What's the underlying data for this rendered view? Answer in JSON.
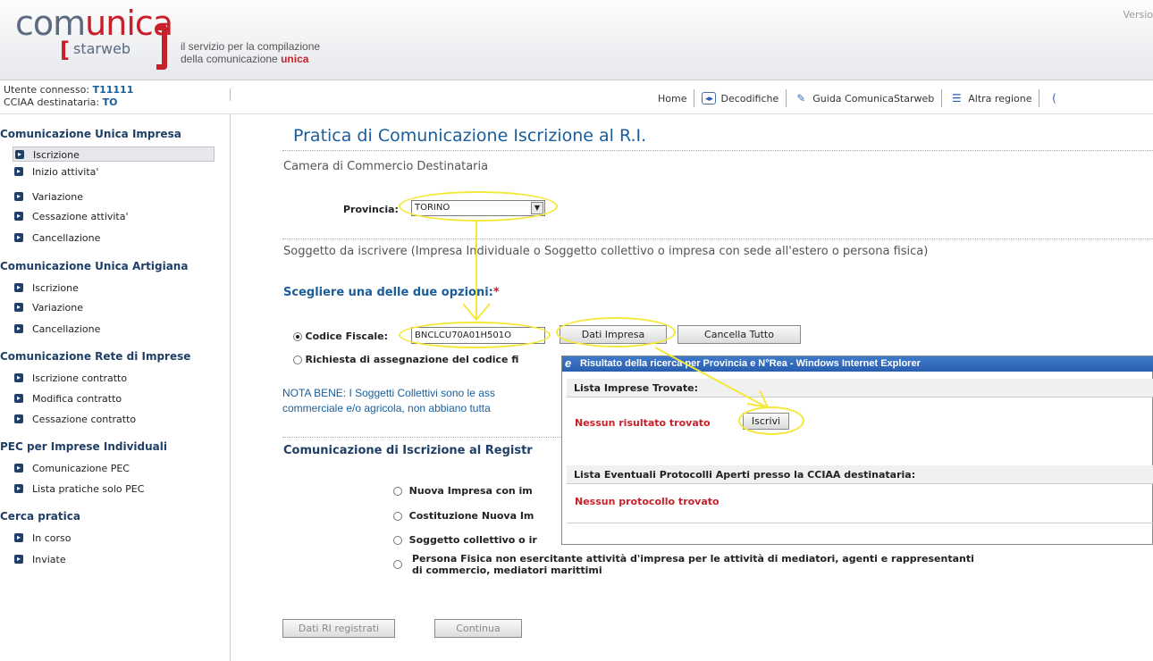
{
  "header": {
    "logo_top_a": "com",
    "logo_top_b": "unica",
    "logo_bottom": "starweb",
    "tagline_1": "il servizio per la compilazione",
    "tagline_2": "della comunicazione ",
    "tagline_2_highlight": "unica",
    "version": "Versio"
  },
  "user": {
    "connected_label": "Utente connesso: ",
    "connected_value": "T11111",
    "cciaa_label": "CCIAA destinataria: ",
    "cciaa_value": "TO"
  },
  "topnav": {
    "home": "Home",
    "decodifiche": "Decodifiche",
    "guida": "Guida ComunicaStarweb",
    "altra_regione": "Altra regione"
  },
  "sidebar": {
    "sections": [
      {
        "title": "Comunicazione Unica Impresa",
        "items": [
          "Iscrizione",
          "Inizio attivita'",
          "Variazione",
          "Cessazione attivita'",
          "Cancellazione"
        ]
      },
      {
        "title": "Comunicazione Unica Artigiana",
        "items": [
          "Iscrizione",
          "Variazione",
          "Cancellazione"
        ]
      },
      {
        "title": "Comunicazione Rete di Imprese",
        "items": [
          "Iscrizione contratto",
          "Modifica contratto",
          "Cessazione contratto"
        ]
      },
      {
        "title": "PEC per Imprese Individuali",
        "items": [
          "Comunicazione PEC",
          "Lista pratiche solo PEC"
        ]
      },
      {
        "title": "Cerca pratica",
        "items": [
          "In corso",
          "Inviate"
        ]
      }
    ]
  },
  "main": {
    "title": "Pratica di Comunicazione Iscrizione al R.I.",
    "camera_section": "Camera di Commercio Destinataria",
    "provincia_label": "Provincia:",
    "provincia_value": "TORINO",
    "soggetto_section": "Soggetto da iscrivere (Impresa Individuale o Soggetto collettivo o impresa con sede all'estero o persona fisica)",
    "scegli": "Scegliere una delle due opzioni:",
    "scegli_req": "*",
    "cf_label": "Codice Fiscale:",
    "cf_value": "BNCLCU70A01H501O",
    "dati_impresa": "Dati Impresa",
    "cancella_tutto": "Cancella Tutto",
    "richiesta_label": "Richiesta di assegnazione del codice fi",
    "nota_1": "NOTA BENE: I Soggetti Collettivi sono le ass",
    "nota_2": "commerciale e/o agricola, non abbiano tutta",
    "comunicazione_title": "Comunicazione di Iscrizione al Registr",
    "options": [
      "Nuova Impresa con im",
      "Costituzione Nuova Im",
      "Soggetto collettivo o ir"
    ],
    "option_4_line1": "Persona Fisica non esercitante attività d'impresa per le attività di mediatori, agenti e rappresentanti",
    "option_4_line2": "di commercio, mediatori marittimi",
    "dati_ri": "Dati RI registrati",
    "continua": "Continua"
  },
  "popup": {
    "title": "Risultato della ricerca per Provincia e N°Rea - Windows Internet Explorer",
    "lista_imprese": "Lista Imprese Trovate:",
    "nessun_risultato": "Nessun risultato trovato",
    "iscrivi": "Iscrivi",
    "lista_protocolli": "Lista Eventuali Protocolli Aperti presso la CCIAA destinataria:",
    "nessun_protocollo": "Nessun protocollo trovato"
  },
  "colors": {
    "brand_red": "#c8202a",
    "brand_blue": "#1a5d9a",
    "navy": "#1f3f66",
    "highlight": "#f5e83a"
  }
}
